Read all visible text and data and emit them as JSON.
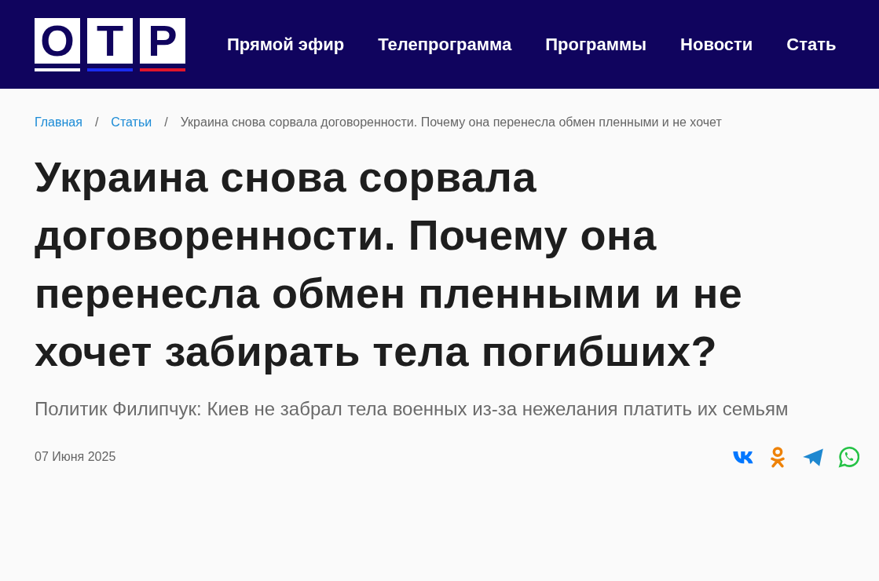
{
  "logo": {
    "letters": [
      "О",
      "Т",
      "Р"
    ]
  },
  "nav": [
    "Прямой эфир",
    "Телепрограмма",
    "Программы",
    "Новости",
    "Стать"
  ],
  "breadcrumbs": [
    {
      "label": "Главная",
      "kind": "link"
    },
    {
      "label": "Статьи",
      "kind": "link"
    },
    {
      "label": "Украина снова сорвала договоренности. Почему она перенесла обмен пленными и не хочет",
      "kind": "current"
    }
  ],
  "breadcrumb_separator": [
    "/",
    "/"
  ],
  "article": {
    "title": "Украина снова сорвала договоренности. Почему она перенесла обмен пленными и не хочет забирать тела погибших?",
    "subtitle": "Политик Филипчук: Киев не забрал тела военных из-за нежелания платить их семьям",
    "date": "07 Июня 2025"
  },
  "share": [
    {
      "kind": "vk",
      "color": "#0077ff"
    },
    {
      "kind": "ok",
      "color": "#ee8208"
    },
    {
      "kind": "telegram",
      "color": "#1e88d0"
    },
    {
      "kind": "whatsapp",
      "color": "#25c246"
    }
  ]
}
